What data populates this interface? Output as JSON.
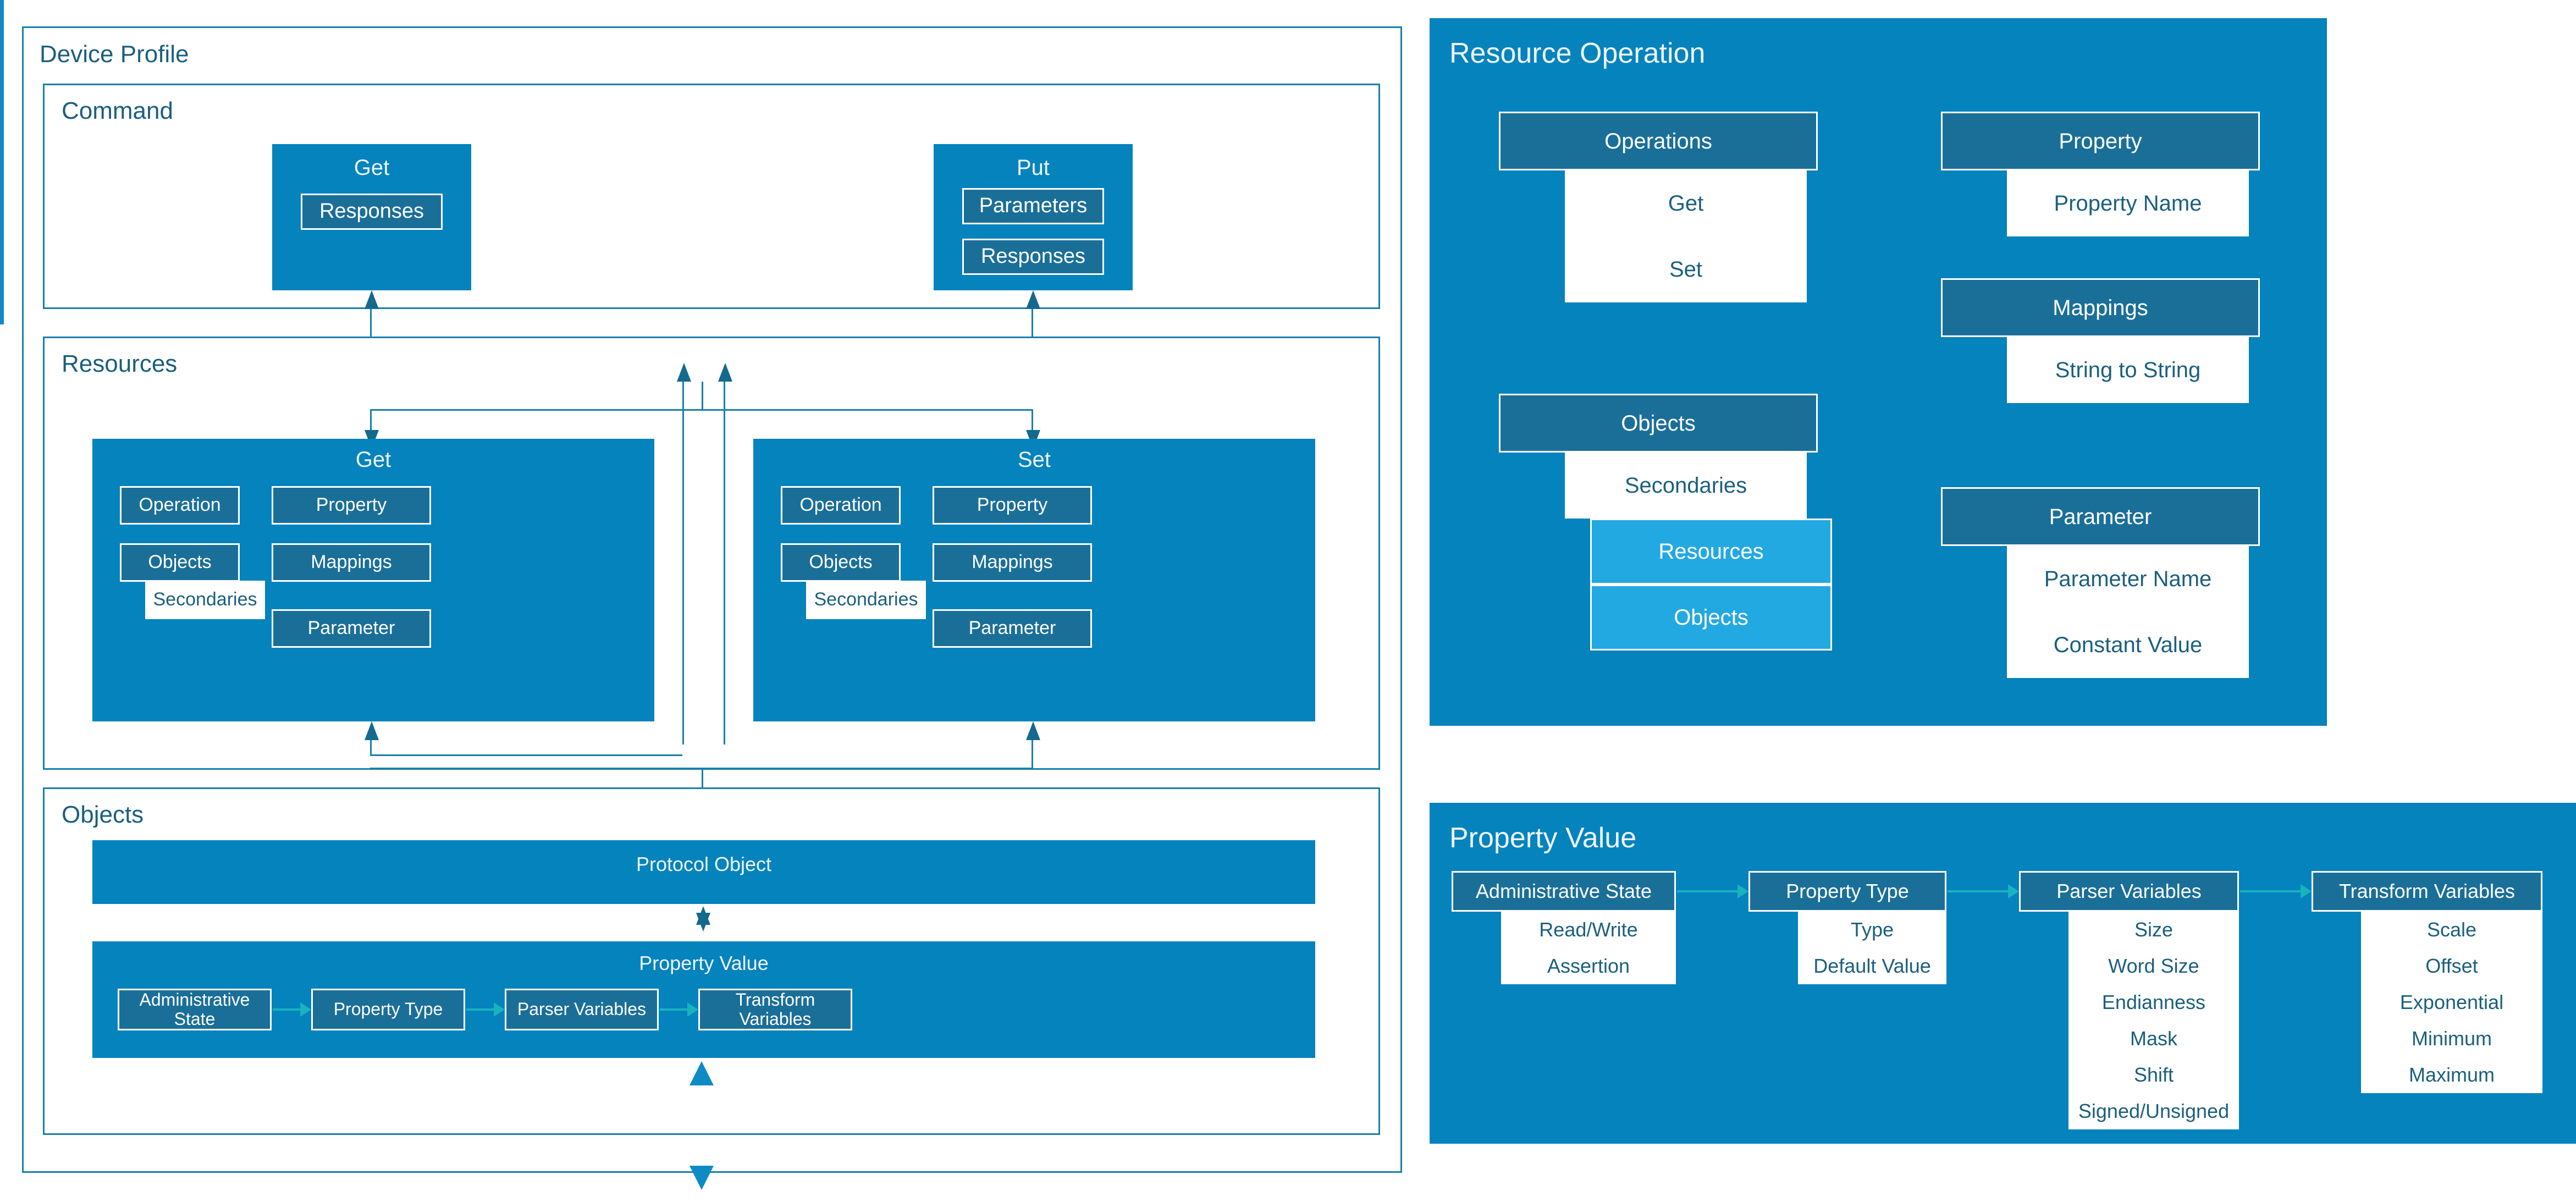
{
  "colors": {
    "panel_blue": "#0483bd",
    "node_dark": "#1a6f99",
    "node_light": "#23a9e1",
    "node_white_bg": "#ffffff",
    "outline": "#1a7fa8",
    "title_text": "#1b5f7e",
    "arrow_teal": "#17b3c0",
    "arrow_blue": "#0e8bc4"
  },
  "device_profile": {
    "title": "Device Profile",
    "command": {
      "title": "Command",
      "get": {
        "title": "Get",
        "children": [
          "Responses"
        ]
      },
      "put": {
        "title": "Put",
        "children": [
          "Parameters",
          "Responses"
        ]
      }
    },
    "resources": {
      "title": "Resources",
      "get": {
        "title": "Get",
        "left_column": [
          "Operation",
          "Objects"
        ],
        "right_column": [
          "Property",
          "Mappings",
          "Parameter"
        ],
        "secondaries": "Secondaries"
      },
      "set": {
        "title": "Set",
        "left_column": [
          "Operation",
          "Objects"
        ],
        "right_column": [
          "Property",
          "Mappings",
          "Parameter"
        ],
        "secondaries": "Secondaries"
      }
    },
    "objects": {
      "title": "Objects",
      "protocol_object": "Protocol Object",
      "property_value": {
        "title": "Property Value",
        "chain": [
          "Administrative State",
          "Property Type",
          "Parser Variables",
          "Transform Variables"
        ]
      }
    }
  },
  "resource_operation": {
    "title": "Resource Operation",
    "operations": {
      "header": "Operations",
      "items": [
        "Get",
        "Set"
      ]
    },
    "property": {
      "header": "Property",
      "items": [
        "Property Name"
      ]
    },
    "mappings": {
      "header": "Mappings",
      "items": [
        "String to String"
      ]
    },
    "objects": {
      "header": "Objects",
      "items": [
        "Secondaries"
      ],
      "highlighted": [
        "Resources",
        "Objects"
      ]
    },
    "parameter": {
      "header": "Parameter",
      "items": [
        "Parameter Name",
        "Constant Value"
      ]
    }
  },
  "property_value_panel": {
    "title": "Property Value",
    "columns": [
      {
        "header": "Administrative State",
        "items": [
          "Read/Write",
          "Assertion"
        ]
      },
      {
        "header": "Property Type",
        "items": [
          "Type",
          "Default Value"
        ]
      },
      {
        "header": "Parser Variables",
        "items": [
          "Size",
          "Word Size",
          "Endianness",
          "Mask",
          "Shift",
          "Signed/Unsigned"
        ]
      },
      {
        "header": "Transform Variables",
        "items": [
          "Scale",
          "Offset",
          "Exponential",
          "Minimum",
          "Maximum"
        ]
      }
    ]
  }
}
